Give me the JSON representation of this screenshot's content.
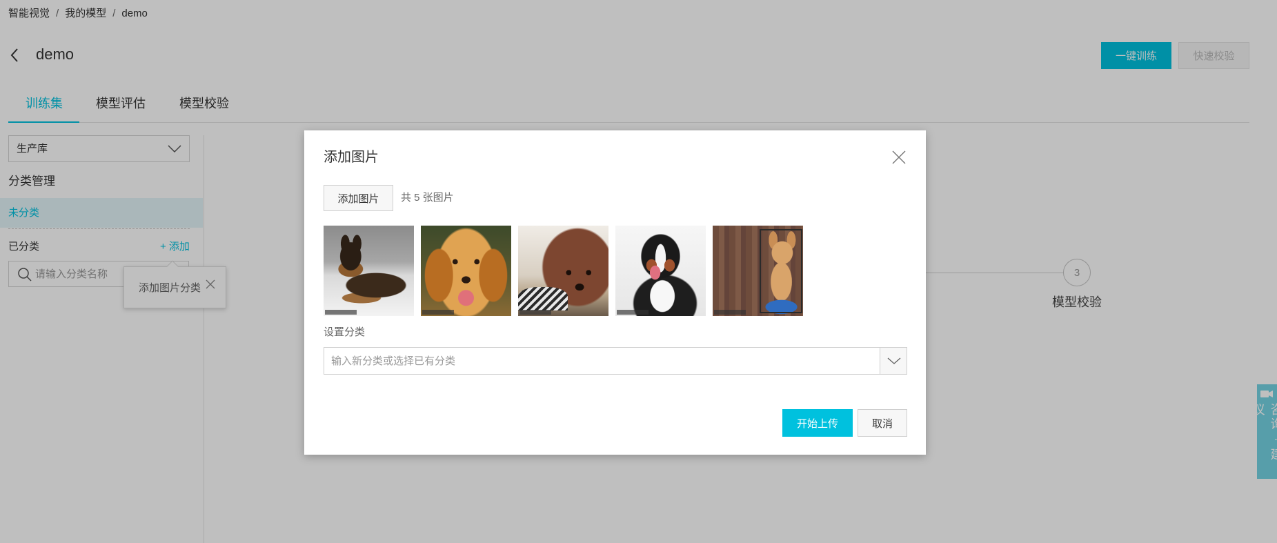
{
  "breadcrumb": {
    "items": [
      "智能视觉",
      "我的模型",
      "demo"
    ],
    "separator": "/"
  },
  "header": {
    "title": "demo",
    "train_button": "一键训练",
    "quick_check_button": "快速校验"
  },
  "tabs": [
    {
      "label": "训练集",
      "active": true
    },
    {
      "label": "模型评估",
      "active": false
    },
    {
      "label": "模型校验",
      "active": false
    }
  ],
  "sidebar": {
    "library_select": "生产库",
    "category_heading": "分类管理",
    "uncategorized": "未分类",
    "categorized": "已分类",
    "add_link": "+ 添加",
    "search_placeholder": "请输入分类名称"
  },
  "tooltip": {
    "text": "添加图片分类"
  },
  "steps": {
    "step_number": "3",
    "step_label": "模型校验"
  },
  "feedback_tab": {
    "text": "咨询·建议"
  },
  "modal": {
    "title": "添加图片",
    "add_button": "添加图片",
    "count_text": "共 5 张图片",
    "category_label": "设置分类",
    "category_placeholder": "输入新分类或选择已有分类",
    "submit_button": "开始上传",
    "cancel_button": "取消"
  },
  "icons": {
    "back": "chevron-left-icon",
    "select": "chevron-down-icon",
    "search": "search-icon",
    "close": "close-icon",
    "feedback": "chat-icon"
  },
  "colors": {
    "accent": "#00c1de",
    "overlay": "rgba(0,0,0,0.25)"
  }
}
